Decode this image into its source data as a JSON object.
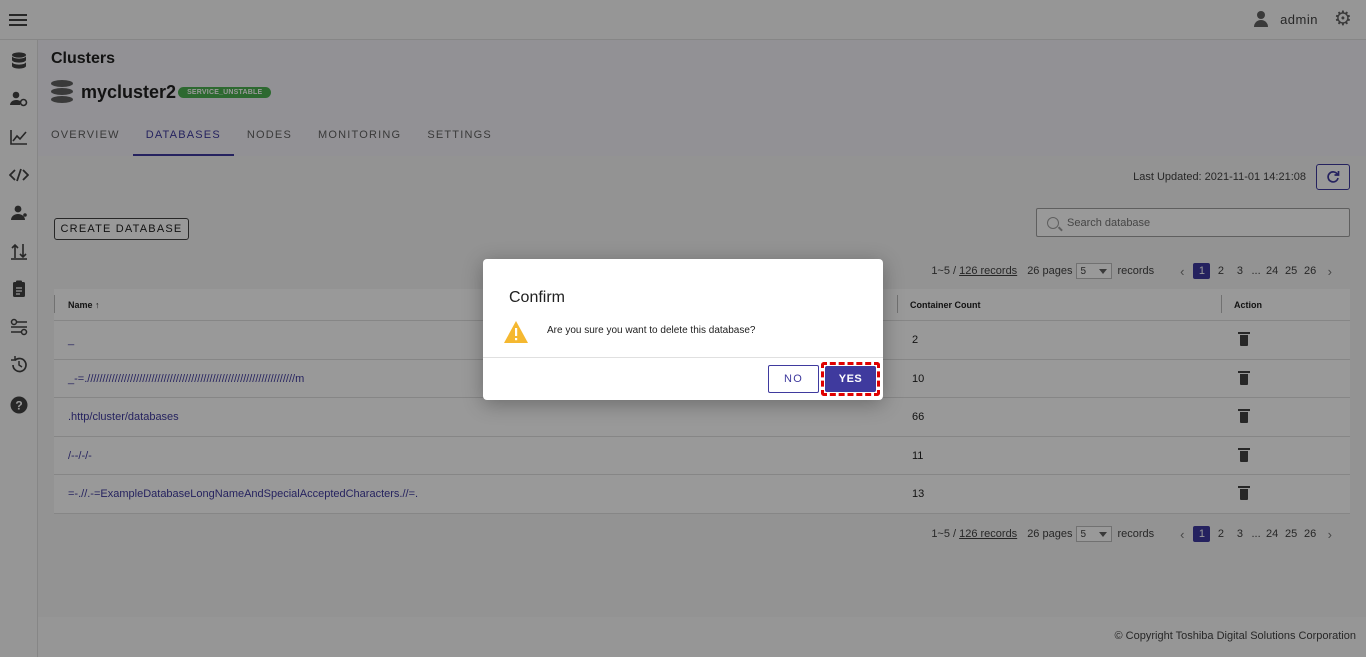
{
  "topbar": {
    "menu_icon": "hamburger-menu-icon",
    "user": "admin",
    "user_icon": "person-icon",
    "settings_icon": "gear-icon"
  },
  "sidebar": {
    "items": [
      {
        "icon": "database-icon"
      },
      {
        "icon": "user-settings-icon"
      },
      {
        "icon": "chart-line-icon"
      },
      {
        "icon": "code-icon"
      },
      {
        "icon": "users-icon"
      },
      {
        "icon": "import-export-icon"
      },
      {
        "icon": "clipboard-icon"
      },
      {
        "icon": "tune-icon"
      },
      {
        "icon": "history-icon"
      },
      {
        "icon": "help-icon"
      }
    ]
  },
  "header": {
    "breadcrumb": "Clusters",
    "cluster_name": "mycluster2",
    "status_badge": "SERVICE_UNSTABLE",
    "tabs": [
      {
        "label": "OVERVIEW",
        "active": false
      },
      {
        "label": "DATABASES",
        "active": true
      },
      {
        "label": "NODES",
        "active": false
      },
      {
        "label": "MONITORING",
        "active": false
      },
      {
        "label": "SETTINGS",
        "active": false
      }
    ]
  },
  "toolbar": {
    "last_updated": "Last Updated: 2021-11-01 14:21:08",
    "create_label": "CREATE DATABASE",
    "search_placeholder": "Search database"
  },
  "pagination": {
    "range": "1~5 /",
    "records_link": "126 records",
    "pages": "26 pages",
    "per_page": "5",
    "records_label": "records",
    "page_buttons": [
      "1",
      "2",
      "3",
      "...",
      "24",
      "25",
      "26"
    ],
    "active_page": "1"
  },
  "table": {
    "columns": [
      "Name",
      "Container Count",
      "Action"
    ],
    "sort_indicator": "↑",
    "rows": [
      {
        "name": "_",
        "count": "2"
      },
      {
        "name": "_-=.////////////////////////////////////////////////////////////////////m",
        "count": "10"
      },
      {
        "name": ".http/cluster/databases",
        "count": "66"
      },
      {
        "name": "/--/-/-",
        "count": "11"
      },
      {
        "name": "=-.//.-=ExampleDatabaseLongNameAndSpecialAcceptedCharacters.//=.",
        "count": "13"
      }
    ]
  },
  "dialog": {
    "title": "Confirm",
    "message": "Are you sure you want to delete this database?",
    "no_label": "NO",
    "yes_label": "YES"
  },
  "footer": {
    "copyright": "© Copyright Toshiba Digital Solutions Corporation"
  },
  "colors": {
    "primary": "#3f3a9e",
    "badge_green": "#4caf50",
    "warning": "#f5b830",
    "highlight": "#e00000"
  }
}
